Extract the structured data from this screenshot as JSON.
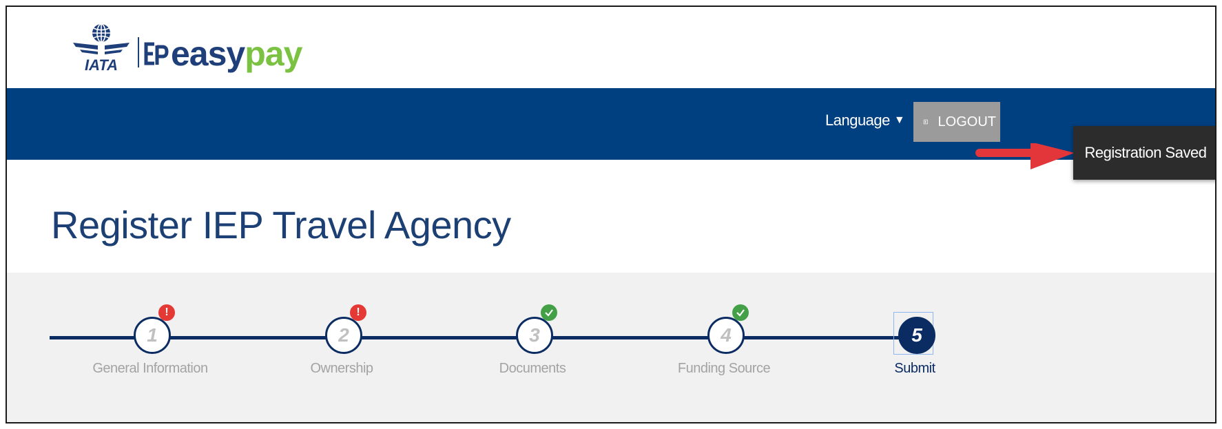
{
  "brand": {
    "iata_text": "IATA",
    "product_name_part1": "easy",
    "product_name_part2": "pay"
  },
  "nav": {
    "language_label": "Language",
    "logout_label": "LOGOUT"
  },
  "toast": {
    "message": "Registration Saved"
  },
  "page": {
    "title": "Register IEP Travel Agency"
  },
  "stepper": {
    "steps": [
      {
        "number": "1",
        "label": "General Information",
        "status": "error",
        "badge": "!"
      },
      {
        "number": "2",
        "label": "Ownership",
        "status": "error",
        "badge": "!"
      },
      {
        "number": "3",
        "label": "Documents",
        "status": "complete",
        "badge": "check"
      },
      {
        "number": "4",
        "label": "Funding Source",
        "status": "complete",
        "badge": "check"
      },
      {
        "number": "5",
        "label": "Submit",
        "status": "active",
        "badge": ""
      }
    ]
  },
  "colors": {
    "nav_bar": "#004080",
    "title": "#1c3f74",
    "stepper_line": "#0b2c63",
    "error_badge": "#e53935",
    "success_badge": "#43a047",
    "brand_green": "#7cc242",
    "toast_bg": "#2c2c2c",
    "annotation_arrow": "#e2363a"
  }
}
